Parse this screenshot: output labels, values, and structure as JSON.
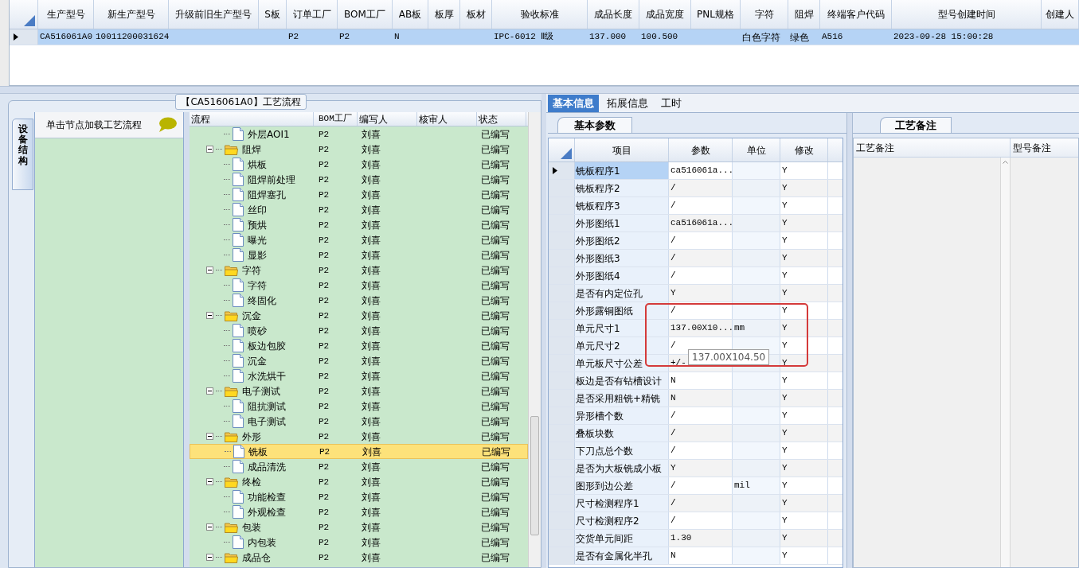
{
  "product_grid": {
    "columns": [
      "生产型号",
      "新生产型号",
      "升级前旧生产型号",
      "S板",
      "订单工厂",
      "BOM工厂",
      "AB板",
      "板厚",
      "板材",
      "验收标准",
      "成品长度",
      "成品宽度",
      "PNL规格",
      "字符",
      "阻焊",
      "终端客户代码",
      "型号创建时间",
      "创建人"
    ],
    "rows": [
      {
        "selected": true,
        "cells": [
          "CA516061A0",
          "10011200031624",
          null,
          null,
          "P2",
          "P2",
          "N",
          null,
          null,
          "IPC-6012 Ⅱ级",
          "137.000",
          "100.500",
          null,
          "白色字符",
          "绿色",
          "A516",
          "2023-09-28 15:00:28",
          null
        ]
      }
    ]
  },
  "process_panel": {
    "title": "【CA516061A0】工艺流程",
    "side_tab": "设备结构",
    "hint": "单击节点加载工艺流程",
    "columns": [
      "流程",
      "BOM工厂",
      "编写人",
      "核审人",
      "状态"
    ],
    "tree": [
      {
        "kind": "step",
        "name": "外层AOI1",
        "bom": "P2",
        "author": "刘喜",
        "status": "已编写",
        "selected": false
      },
      {
        "kind": "group",
        "name": "阻焊",
        "bom": "P2",
        "author": "刘喜",
        "status": "已编写",
        "selected": false,
        "expanded": true,
        "children": [
          {
            "kind": "step",
            "name": "烘板",
            "bom": "P2",
            "author": "刘喜",
            "status": "已编写",
            "selected": false
          },
          {
            "kind": "step",
            "name": "阻焊前处理",
            "bom": "P2",
            "author": "刘喜",
            "status": "已编写",
            "selected": false
          },
          {
            "kind": "step",
            "name": "阻焊塞孔",
            "bom": "P2",
            "author": "刘喜",
            "status": "已编写",
            "selected": false
          },
          {
            "kind": "step",
            "name": "丝印",
            "bom": "P2",
            "author": "刘喜",
            "status": "已编写",
            "selected": false
          },
          {
            "kind": "step",
            "name": "预烘",
            "bom": "P2",
            "author": "刘喜",
            "status": "已编写",
            "selected": false
          },
          {
            "kind": "step",
            "name": "曝光",
            "bom": "P2",
            "author": "刘喜",
            "status": "已编写",
            "selected": false
          },
          {
            "kind": "step",
            "name": "显影",
            "bom": "P2",
            "author": "刘喜",
            "status": "已编写",
            "selected": false
          }
        ]
      },
      {
        "kind": "group",
        "name": "字符",
        "bom": "P2",
        "author": "刘喜",
        "status": "已编写",
        "selected": false,
        "expanded": true,
        "children": [
          {
            "kind": "step",
            "name": "字符",
            "bom": "P2",
            "author": "刘喜",
            "status": "已编写",
            "selected": false
          },
          {
            "kind": "step",
            "name": "终固化",
            "bom": "P2",
            "author": "刘喜",
            "status": "已编写",
            "selected": false
          }
        ]
      },
      {
        "kind": "group",
        "name": "沉金",
        "bom": "P2",
        "author": "刘喜",
        "status": "已编写",
        "selected": false,
        "expanded": true,
        "children": [
          {
            "kind": "step",
            "name": "喷砂",
            "bom": "P2",
            "author": "刘喜",
            "status": "已编写",
            "selected": false
          },
          {
            "kind": "step",
            "name": "板边包胶",
            "bom": "P2",
            "author": "刘喜",
            "status": "已编写",
            "selected": false
          },
          {
            "kind": "step",
            "name": "沉金",
            "bom": "P2",
            "author": "刘喜",
            "status": "已编写",
            "selected": false
          },
          {
            "kind": "step",
            "name": "水洗烘干",
            "bom": "P2",
            "author": "刘喜",
            "status": "已编写",
            "selected": false
          }
        ]
      },
      {
        "kind": "group",
        "name": "电子测试",
        "bom": "P2",
        "author": "刘喜",
        "status": "已编写",
        "selected": false,
        "expanded": true,
        "children": [
          {
            "kind": "step",
            "name": "阻抗测试",
            "bom": "P2",
            "author": "刘喜",
            "status": "已编写",
            "selected": false
          },
          {
            "kind": "step",
            "name": "电子测试",
            "bom": "P2",
            "author": "刘喜",
            "status": "已编写",
            "selected": false
          }
        ]
      },
      {
        "kind": "group",
        "name": "外形",
        "bom": "P2",
        "author": "刘喜",
        "status": "已编写",
        "selected": false,
        "expanded": true,
        "children": [
          {
            "kind": "step",
            "name": "铣板",
            "bom": "P2",
            "author": "刘喜",
            "status": "已编写",
            "selected": true
          },
          {
            "kind": "step",
            "name": "成品清洗",
            "bom": "P2",
            "author": "刘喜",
            "status": "已编写",
            "selected": false
          }
        ]
      },
      {
        "kind": "group",
        "name": "终检",
        "bom": "P2",
        "author": "刘喜",
        "status": "已编写",
        "selected": false,
        "expanded": true,
        "children": [
          {
            "kind": "step",
            "name": "功能检查",
            "bom": "P2",
            "author": "刘喜",
            "status": "已编写",
            "selected": false
          },
          {
            "kind": "step",
            "name": "外观检查",
            "bom": "P2",
            "author": "刘喜",
            "status": "已编写",
            "selected": false
          }
        ]
      },
      {
        "kind": "group",
        "name": "包装",
        "bom": "P2",
        "author": "刘喜",
        "status": "已编写",
        "selected": false,
        "expanded": true,
        "children": [
          {
            "kind": "step",
            "name": "内包装",
            "bom": "P2",
            "author": "刘喜",
            "status": "已编写",
            "selected": false
          }
        ]
      },
      {
        "kind": "group",
        "name": "成品仓",
        "bom": "P2",
        "author": "刘喜",
        "status": "已编写",
        "selected": false,
        "expanded": true
      }
    ]
  },
  "detail_tabs": [
    {
      "label": "基本信息",
      "selected": true
    },
    {
      "label": "拓展信息",
      "selected": false
    },
    {
      "label": "工时",
      "selected": false
    }
  ],
  "params": {
    "tab": "基本参数",
    "columns": [
      "项目",
      "参数",
      "单位",
      "修改"
    ],
    "rows": [
      {
        "item": "铣板程序1",
        "value": "ca516061a...",
        "modify": "Y",
        "selected": true
      },
      {
        "item": "铣板程序2",
        "value": "/",
        "modify": "Y",
        "selected": false
      },
      {
        "item": "铣板程序3",
        "value": "/",
        "modify": "Y",
        "selected": false
      },
      {
        "item": "外形图纸1",
        "value": "ca516061a...",
        "modify": "Y",
        "selected": false
      },
      {
        "item": "外形图纸2",
        "value": "/",
        "modify": "Y",
        "selected": false
      },
      {
        "item": "外形图纸3",
        "value": "/",
        "modify": "Y",
        "selected": false
      },
      {
        "item": "外形图纸4",
        "value": "/",
        "modify": "Y",
        "selected": false
      },
      {
        "item": "是否有内定位孔",
        "value": "Y",
        "modify": "Y",
        "selected": false
      },
      {
        "item": "外形露铜图纸",
        "value": "/",
        "modify": "Y",
        "selected": false
      },
      {
        "item": "单元尺寸1",
        "value": "137.00X10...",
        "unit": "mm",
        "modify": "Y",
        "selected": false
      },
      {
        "item": "单元尺寸2",
        "value": "/",
        "modify": "Y",
        "selected": false
      },
      {
        "item": "单元板尺寸公差",
        "value": "+/-",
        "modify": "Y",
        "selected": false
      },
      {
        "item": "板边是否有钻槽设计",
        "value": "N",
        "modify": "Y",
        "selected": false
      },
      {
        "item": "是否采用粗铣+精铣",
        "value": "N",
        "modify": "Y",
        "selected": false
      },
      {
        "item": "异形槽个数",
        "value": "/",
        "modify": "Y",
        "selected": false
      },
      {
        "item": "叠板块数",
        "value": "/",
        "modify": "Y",
        "selected": false
      },
      {
        "item": "下刀点总个数",
        "value": "/",
        "modify": "Y",
        "selected": false
      },
      {
        "item": "是否为大板铣成小板",
        "value": "Y",
        "modify": "Y",
        "selected": false
      },
      {
        "item": "图形到边公差",
        "value": "/",
        "unit": "mil",
        "modify": "Y",
        "selected": false
      },
      {
        "item": "尺寸检测程序1",
        "value": "/",
        "modify": "Y",
        "selected": false
      },
      {
        "item": "尺寸检测程序2",
        "value": "/",
        "modify": "Y",
        "selected": false
      },
      {
        "item": "交货单元间距",
        "value": "1.30",
        "modify": "Y",
        "selected": false
      },
      {
        "item": "是否有金属化半孔",
        "value": "N",
        "modify": "Y",
        "selected": false
      }
    ],
    "tooltip": "137.00X104.50"
  },
  "notes": {
    "tab": "工艺备注",
    "columns": [
      "工艺备注",
      "型号备注"
    ]
  }
}
